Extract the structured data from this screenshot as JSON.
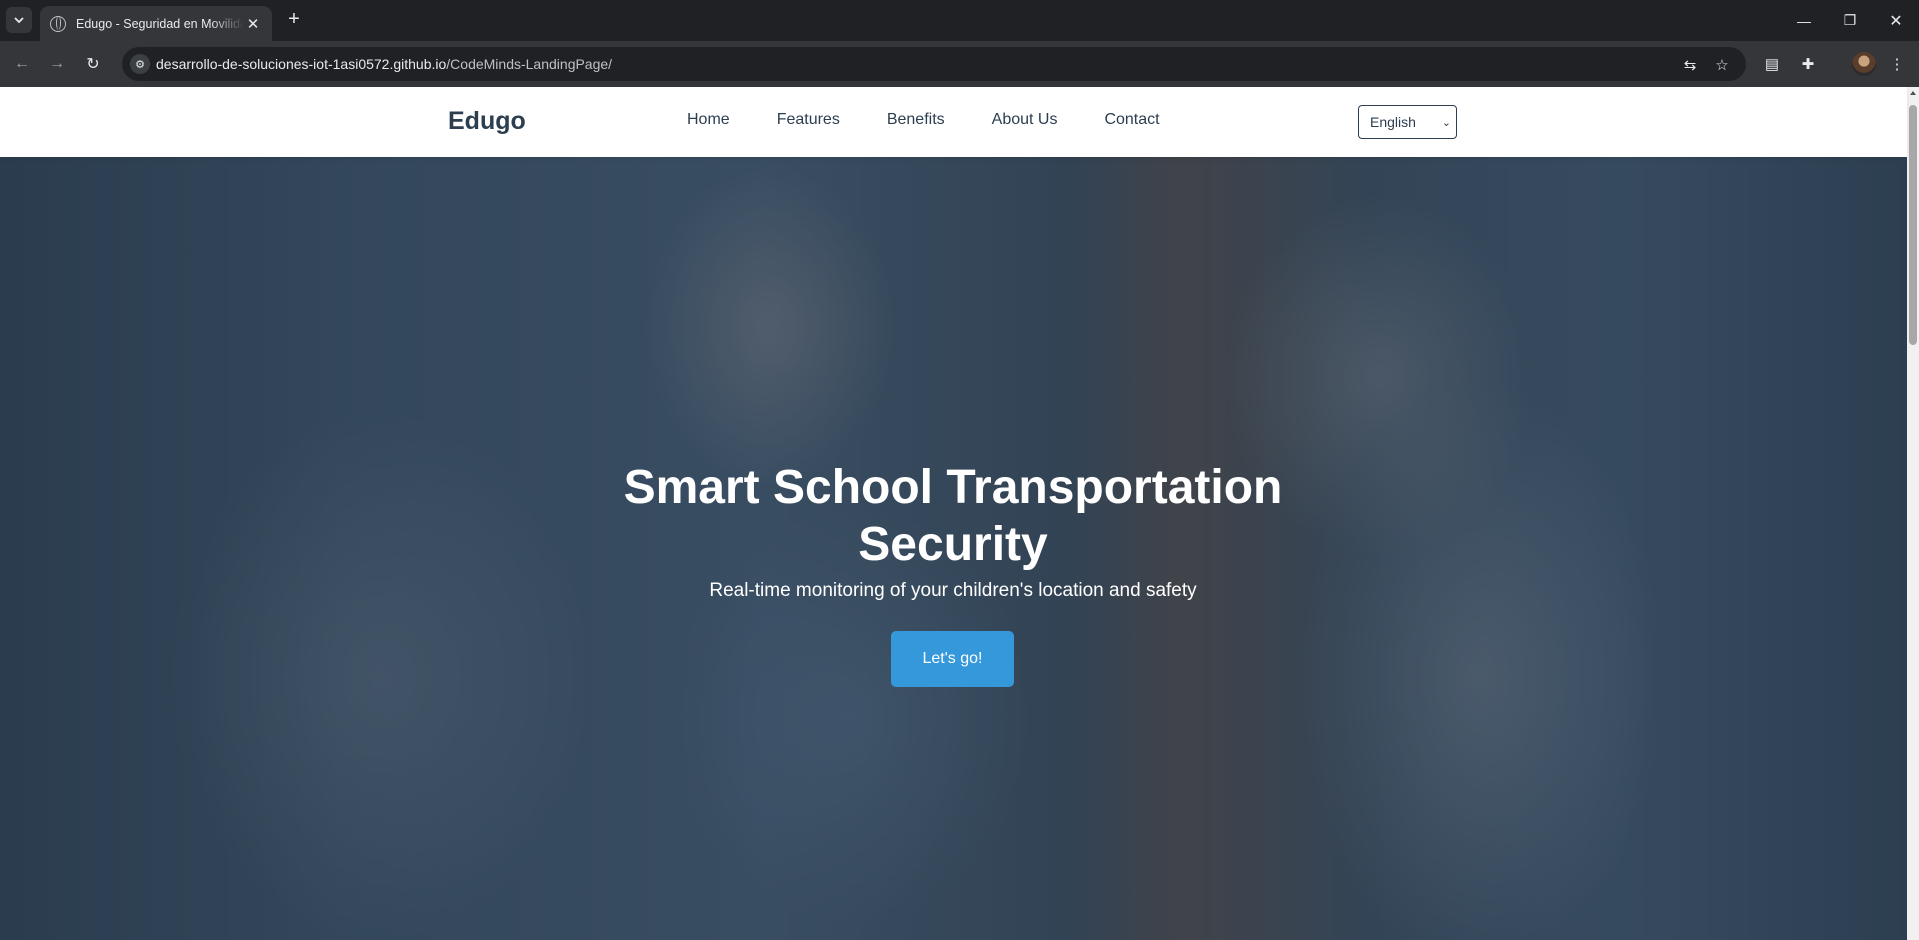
{
  "browser": {
    "tab_title": "Edugo - Seguridad en Movilidad",
    "url_host": "desarrollo-de-soluciones-iot-1asi0572.github.io",
    "url_path": "/CodeMinds-LandingPage/"
  },
  "site": {
    "logo": "Edugo",
    "nav": [
      "Home",
      "Features",
      "Benefits",
      "About Us",
      "Contact"
    ],
    "language": {
      "selected": "English"
    }
  },
  "hero": {
    "title": "Smart School Transportation Security",
    "subtitle": "Real-time monitoring of your children's location and safety",
    "cta": "Let's go!"
  },
  "colors": {
    "primary": "#2c3e50",
    "accent": "#3498db"
  }
}
